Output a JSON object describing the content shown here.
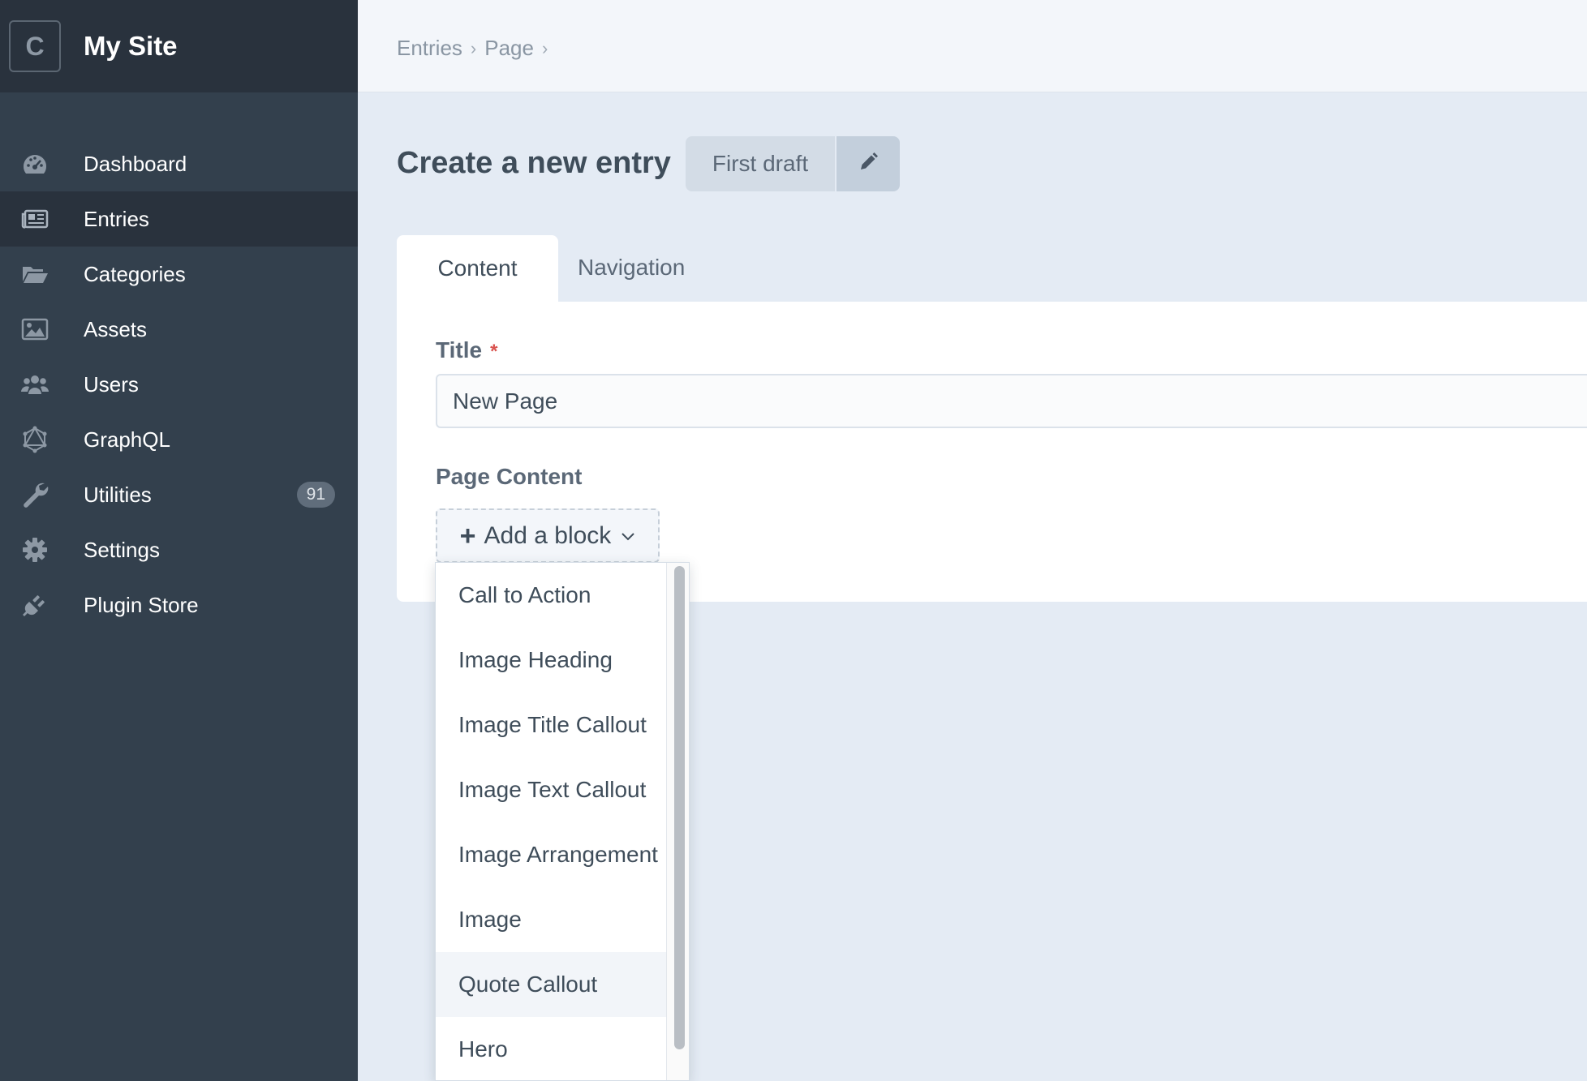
{
  "app": {
    "logo_letter": "C",
    "site_name": "My Site"
  },
  "sidebar": {
    "items": [
      {
        "label": "Dashboard",
        "icon": "dashboard-icon"
      },
      {
        "label": "Entries",
        "icon": "newspaper-icon",
        "active": true
      },
      {
        "label": "Categories",
        "icon": "folder-open-icon"
      },
      {
        "label": "Assets",
        "icon": "image-icon"
      },
      {
        "label": "Users",
        "icon": "users-icon"
      },
      {
        "label": "GraphQL",
        "icon": "graphql-icon"
      },
      {
        "label": "Utilities",
        "icon": "wrench-icon",
        "badge": "91"
      },
      {
        "label": "Settings",
        "icon": "gear-icon"
      },
      {
        "label": "Plugin Store",
        "icon": "plug-icon"
      }
    ]
  },
  "breadcrumb": {
    "items": [
      "Entries",
      "Page"
    ],
    "separator": "›"
  },
  "header": {
    "title": "Create a new entry",
    "draft_label": "First draft"
  },
  "tabs": [
    {
      "label": "Content",
      "active": true
    },
    {
      "label": "Navigation",
      "active": false
    }
  ],
  "form": {
    "title_label": "Title",
    "required_mark": "*",
    "title_value": "New Page",
    "page_content_label": "Page Content",
    "add_block_plus": "+",
    "add_block_label": "Add a block"
  },
  "block_menu": {
    "items": [
      "Call to Action",
      "Image Heading",
      "Image Title Callout",
      "Image Text Callout",
      "Image Arrangement",
      "Image",
      "Quote Callout",
      "Hero"
    ],
    "hovered_item": "Quote Callout"
  },
  "colors": {
    "sidebar_bg": "#33404d",
    "sidebar_header_bg": "#29323d",
    "content_bg": "#e4ebf4",
    "badge_bg": "#606d7b",
    "required": "#d9534f"
  }
}
